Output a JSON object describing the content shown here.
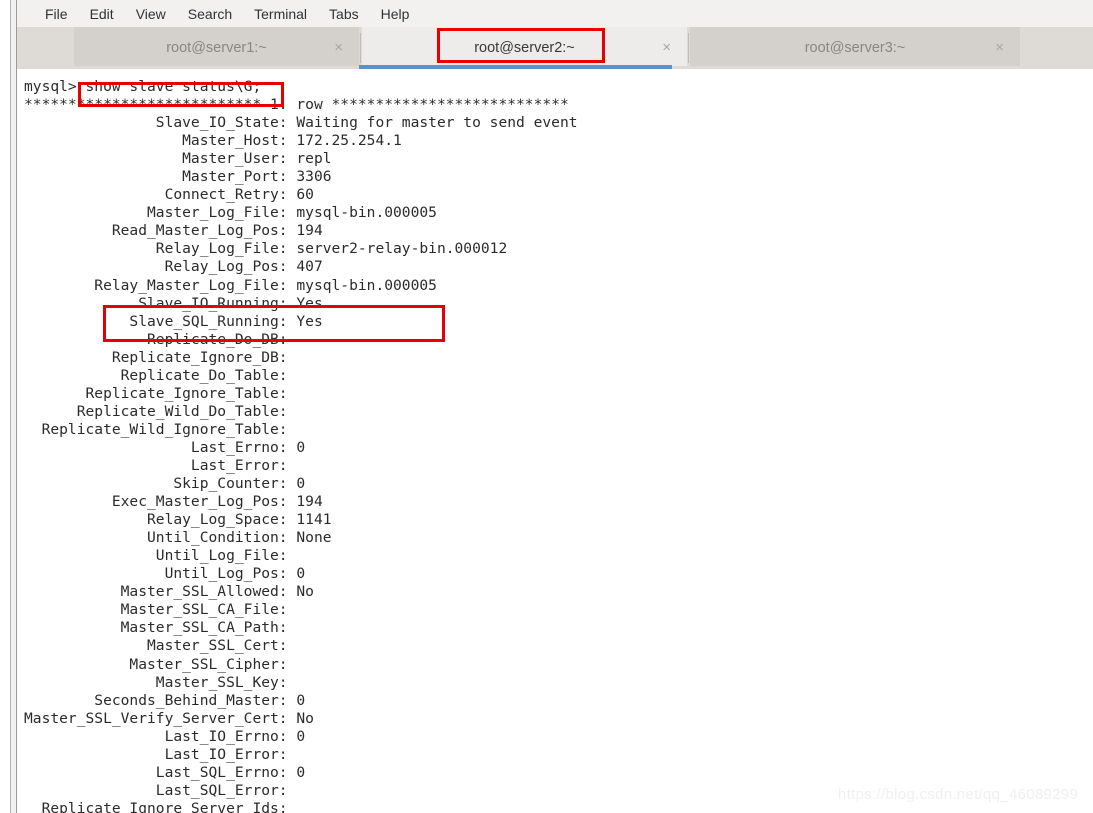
{
  "window": {
    "menu": {
      "items": [
        {
          "label": "File"
        },
        {
          "label": "Edit"
        },
        {
          "label": "View"
        },
        {
          "label": "Search"
        },
        {
          "label": "Terminal"
        },
        {
          "label": "Tabs"
        },
        {
          "label": "Help"
        }
      ]
    },
    "tabs": [
      {
        "label": "root@server1:~",
        "active": false,
        "close_icon": "×"
      },
      {
        "label": "root@server2:~",
        "active": true,
        "close_icon": "×"
      },
      {
        "label": "root@server3:~",
        "active": false,
        "close_icon": "×"
      }
    ]
  },
  "terminal": {
    "prompt": "mysql>",
    "command": "show slave status\\G;",
    "prompt_line": "mysql> show slave status\\G;",
    "row_separator": "*************************** 1. row ***************************",
    "lines": [
      "               Slave_IO_State: Waiting for master to send event",
      "                  Master_Host: 172.25.254.1",
      "                  Master_User: repl",
      "                  Master_Port: 3306",
      "                Connect_Retry: 60",
      "              Master_Log_File: mysql-bin.000005",
      "          Read_Master_Log_Pos: 194",
      "               Relay_Log_File: server2-relay-bin.000012",
      "                Relay_Log_Pos: 407",
      "        Relay_Master_Log_File: mysql-bin.000005",
      "             Slave_IO_Running: Yes",
      "            Slave_SQL_Running: Yes",
      "              Replicate_Do_DB:",
      "          Replicate_Ignore_DB:",
      "           Replicate_Do_Table:",
      "       Replicate_Ignore_Table:",
      "      Replicate_Wild_Do_Table:",
      "  Replicate_Wild_Ignore_Table:",
      "                   Last_Errno: 0",
      "                   Last_Error:",
      "                 Skip_Counter: 0",
      "          Exec_Master_Log_Pos: 194",
      "              Relay_Log_Space: 1141",
      "              Until_Condition: None",
      "               Until_Log_File:",
      "                Until_Log_Pos: 0",
      "           Master_SSL_Allowed: No",
      "           Master_SSL_CA_File:",
      "           Master_SSL_CA_Path:",
      "              Master_SSL_Cert:",
      "            Master_SSL_Cipher:",
      "               Master_SSL_Key:",
      "        Seconds_Behind_Master: 0",
      "Master_SSL_Verify_Server_Cert: No",
      "                Last_IO_Errno: 0",
      "                Last_IO_Error:",
      "               Last_SQL_Errno: 0",
      "               Last_SQL_Error:",
      "  Replicate_Ignore_Server_Ids:"
    ]
  },
  "annotations": {
    "color": "#e60000",
    "boxes": [
      {
        "name": "tab-highlight",
        "target": "root@server2:~"
      },
      {
        "name": "command-highlight",
        "target": "show slave status\\G;"
      },
      {
        "name": "slave-running-highlight",
        "target": "Slave_IO_Running / Slave_SQL_Running"
      }
    ]
  },
  "watermark": {
    "text": "https://blog.csdn.net/qq_46089299"
  }
}
